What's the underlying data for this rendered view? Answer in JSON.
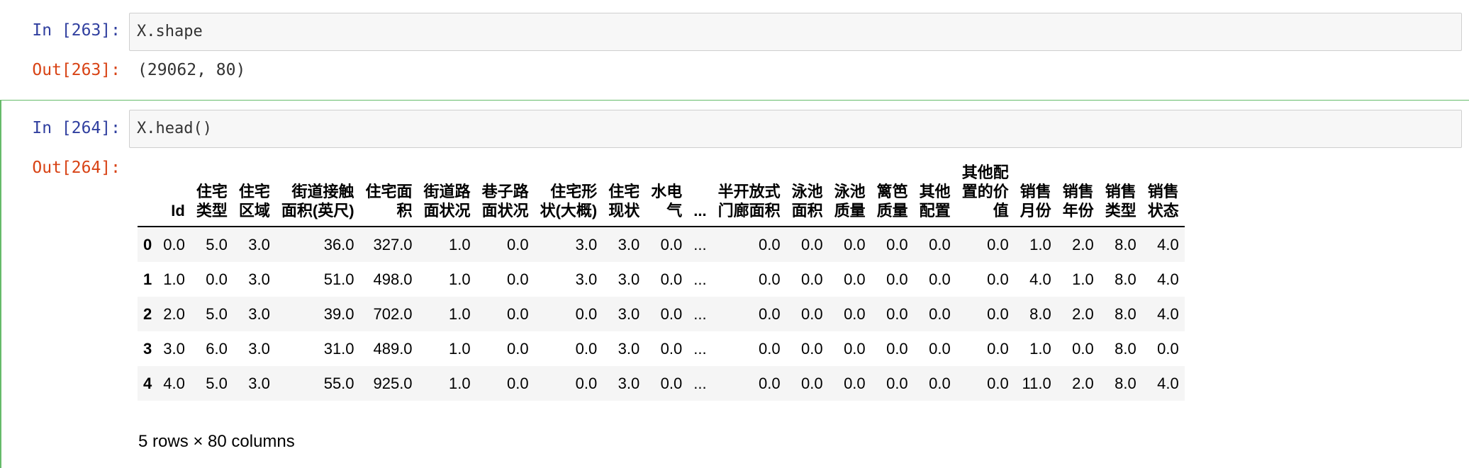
{
  "cell1": {
    "in_prompt": "In  [263]:",
    "code": "X.shape",
    "out_prompt": "Out[263]:",
    "output": "(29062, 80)"
  },
  "cell2": {
    "in_prompt": "In  [264]:",
    "code": "X.head()",
    "out_prompt": "Out[264]:",
    "table": {
      "columns": [
        "Id",
        "住宅\n类型",
        "住宅\n区域",
        "街道接触\n面积(英尺)",
        "住宅面\n积",
        "街道路\n面状况",
        "巷子路\n面状况",
        "住宅形\n状(大概)",
        "住宅\n现状",
        "水电\n气",
        "...",
        "半开放式\n门廊面积",
        "泳池\n面积",
        "泳池\n质量",
        "篱笆\n质量",
        "其他\n配置",
        "其他配\n置的价\n值",
        "销售\n月份",
        "销售\n年份",
        "销售\n类型",
        "销售\n状态"
      ],
      "rows": [
        {
          "index": "0",
          "values": [
            "0.0",
            "5.0",
            "3.0",
            "36.0",
            "327.0",
            "1.0",
            "0.0",
            "3.0",
            "3.0",
            "0.0",
            "...",
            "0.0",
            "0.0",
            "0.0",
            "0.0",
            "0.0",
            "0.0",
            "1.0",
            "2.0",
            "8.0",
            "4.0"
          ]
        },
        {
          "index": "1",
          "values": [
            "1.0",
            "0.0",
            "3.0",
            "51.0",
            "498.0",
            "1.0",
            "0.0",
            "3.0",
            "3.0",
            "0.0",
            "...",
            "0.0",
            "0.0",
            "0.0",
            "0.0",
            "0.0",
            "0.0",
            "4.0",
            "1.0",
            "8.0",
            "4.0"
          ]
        },
        {
          "index": "2",
          "values": [
            "2.0",
            "5.0",
            "3.0",
            "39.0",
            "702.0",
            "1.0",
            "0.0",
            "0.0",
            "3.0",
            "0.0",
            "...",
            "0.0",
            "0.0",
            "0.0",
            "0.0",
            "0.0",
            "0.0",
            "8.0",
            "2.0",
            "8.0",
            "4.0"
          ]
        },
        {
          "index": "3",
          "values": [
            "3.0",
            "6.0",
            "3.0",
            "31.0",
            "489.0",
            "1.0",
            "0.0",
            "0.0",
            "3.0",
            "0.0",
            "...",
            "0.0",
            "0.0",
            "0.0",
            "0.0",
            "0.0",
            "0.0",
            "1.0",
            "0.0",
            "8.0",
            "0.0"
          ]
        },
        {
          "index": "4",
          "values": [
            "4.0",
            "5.0",
            "3.0",
            "55.0",
            "925.0",
            "1.0",
            "0.0",
            "0.0",
            "3.0",
            "0.0",
            "...",
            "0.0",
            "0.0",
            "0.0",
            "0.0",
            "0.0",
            "0.0",
            "11.0",
            "2.0",
            "8.0",
            "4.0"
          ]
        }
      ]
    },
    "shape_note": "5 rows × 80 columns"
  }
}
